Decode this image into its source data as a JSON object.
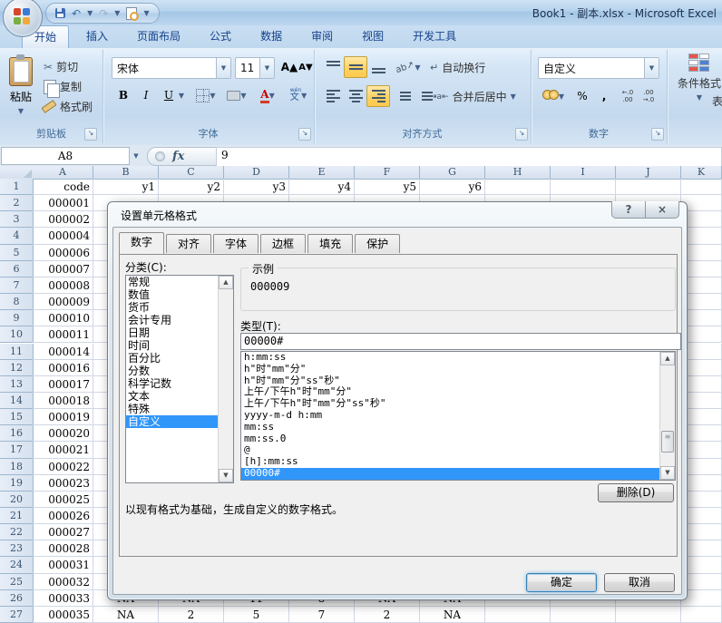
{
  "window": {
    "title": "Book1 - 副本.xlsx - Microsoft Excel"
  },
  "icons": {
    "cut": "✂",
    "undo": "↶",
    "redo": "↷",
    "dropdown": "▼",
    "launcher": "↘",
    "scroll_up": "▲",
    "scroll_down": "▼",
    "help": "?",
    "close": "×",
    "wrap_return": "↵",
    "orientation": "ab↗",
    "bold": "B",
    "italic": "I",
    "underline": "U",
    "font_color_letter": "A",
    "grow_font": "A▲",
    "shrink_font": "A▼",
    "percent": "%",
    "comma": ",",
    "inc_decimal": "←.0\n.00",
    "dec_decimal": ".00\n→.0",
    "phonetic_top": "wén",
    "phonetic_bottom": "文",
    "fx": "fx",
    "merge_icon": "⇥a⇤"
  },
  "ribbon": {
    "tabs": [
      {
        "label": "开始",
        "active": true
      },
      {
        "label": "插入",
        "active": false
      },
      {
        "label": "页面布局",
        "active": false
      },
      {
        "label": "公式",
        "active": false
      },
      {
        "label": "数据",
        "active": false
      },
      {
        "label": "审阅",
        "active": false
      },
      {
        "label": "视图",
        "active": false
      },
      {
        "label": "开发工具",
        "active": false
      }
    ],
    "clipboard": {
      "group": "剪贴板",
      "paste": "粘贴",
      "cut": "剪切",
      "copy": "复制",
      "format_painter": "格式刷"
    },
    "font": {
      "group": "字体",
      "font_name": "宋体",
      "font_size": "11"
    },
    "alignment": {
      "group": "对齐方式",
      "wrap": "自动换行",
      "merge": "合并后居中"
    },
    "number": {
      "group": "数字",
      "format": "自定义"
    },
    "styles": {
      "conditional": "条件格式",
      "table_partial": "表"
    }
  },
  "formula_bar": {
    "name_box": "A8",
    "value": "9"
  },
  "sheet": {
    "columns": [
      "A",
      "B",
      "C",
      "D",
      "E",
      "F",
      "G",
      "H",
      "I",
      "J",
      "K"
    ],
    "header_row": {
      "A": "code",
      "B": "y1",
      "C": "y2",
      "D": "y3",
      "E": "y4",
      "F": "y5",
      "G": "y6"
    },
    "codes": [
      "000001",
      "000002",
      "000004",
      "000006",
      "000007",
      "000008",
      "000009",
      "000010",
      "000011",
      "000014",
      "000016",
      "000017",
      "000018",
      "000019",
      "000020",
      "000021",
      "000022",
      "000023",
      "000025",
      "000026",
      "000027",
      "000028",
      "000031",
      "000032",
      "000033",
      "000035"
    ],
    "row26": [
      "NA",
      "NA",
      "11",
      "8",
      "NA",
      "NA"
    ],
    "row27": [
      "NA",
      "2",
      "5",
      "7",
      "2",
      "NA"
    ]
  },
  "dialog": {
    "title": "设置单元格格式",
    "tabs": [
      "数字",
      "对齐",
      "字体",
      "边框",
      "填充",
      "保护"
    ],
    "active_tab": "数字",
    "category_label": "分类(C):",
    "categories": [
      "常规",
      "数值",
      "货币",
      "会计专用",
      "日期",
      "时间",
      "百分比",
      "分数",
      "科学记数",
      "文本",
      "特殊",
      "自定义"
    ],
    "selected_category": "自定义",
    "sample_label": "示例",
    "sample_value": "000009",
    "type_label": "类型(T):",
    "type_value": "00000#",
    "type_list": [
      "h:mm:ss",
      "h\"时\"mm\"分\"",
      "h\"时\"mm\"分\"ss\"秒\"",
      "上午/下午h\"时\"mm\"分\"",
      "上午/下午h\"时\"mm\"分\"ss\"秒\"",
      "yyyy-m-d h:mm",
      "mm:ss",
      "mm:ss.0",
      "@",
      "[h]:mm:ss",
      "00000#"
    ],
    "selected_type": "00000#",
    "delete_button": "删除(D)",
    "description": "以现有格式为基础，生成自定义的数字格式。",
    "ok": "确定",
    "cancel": "取消"
  }
}
